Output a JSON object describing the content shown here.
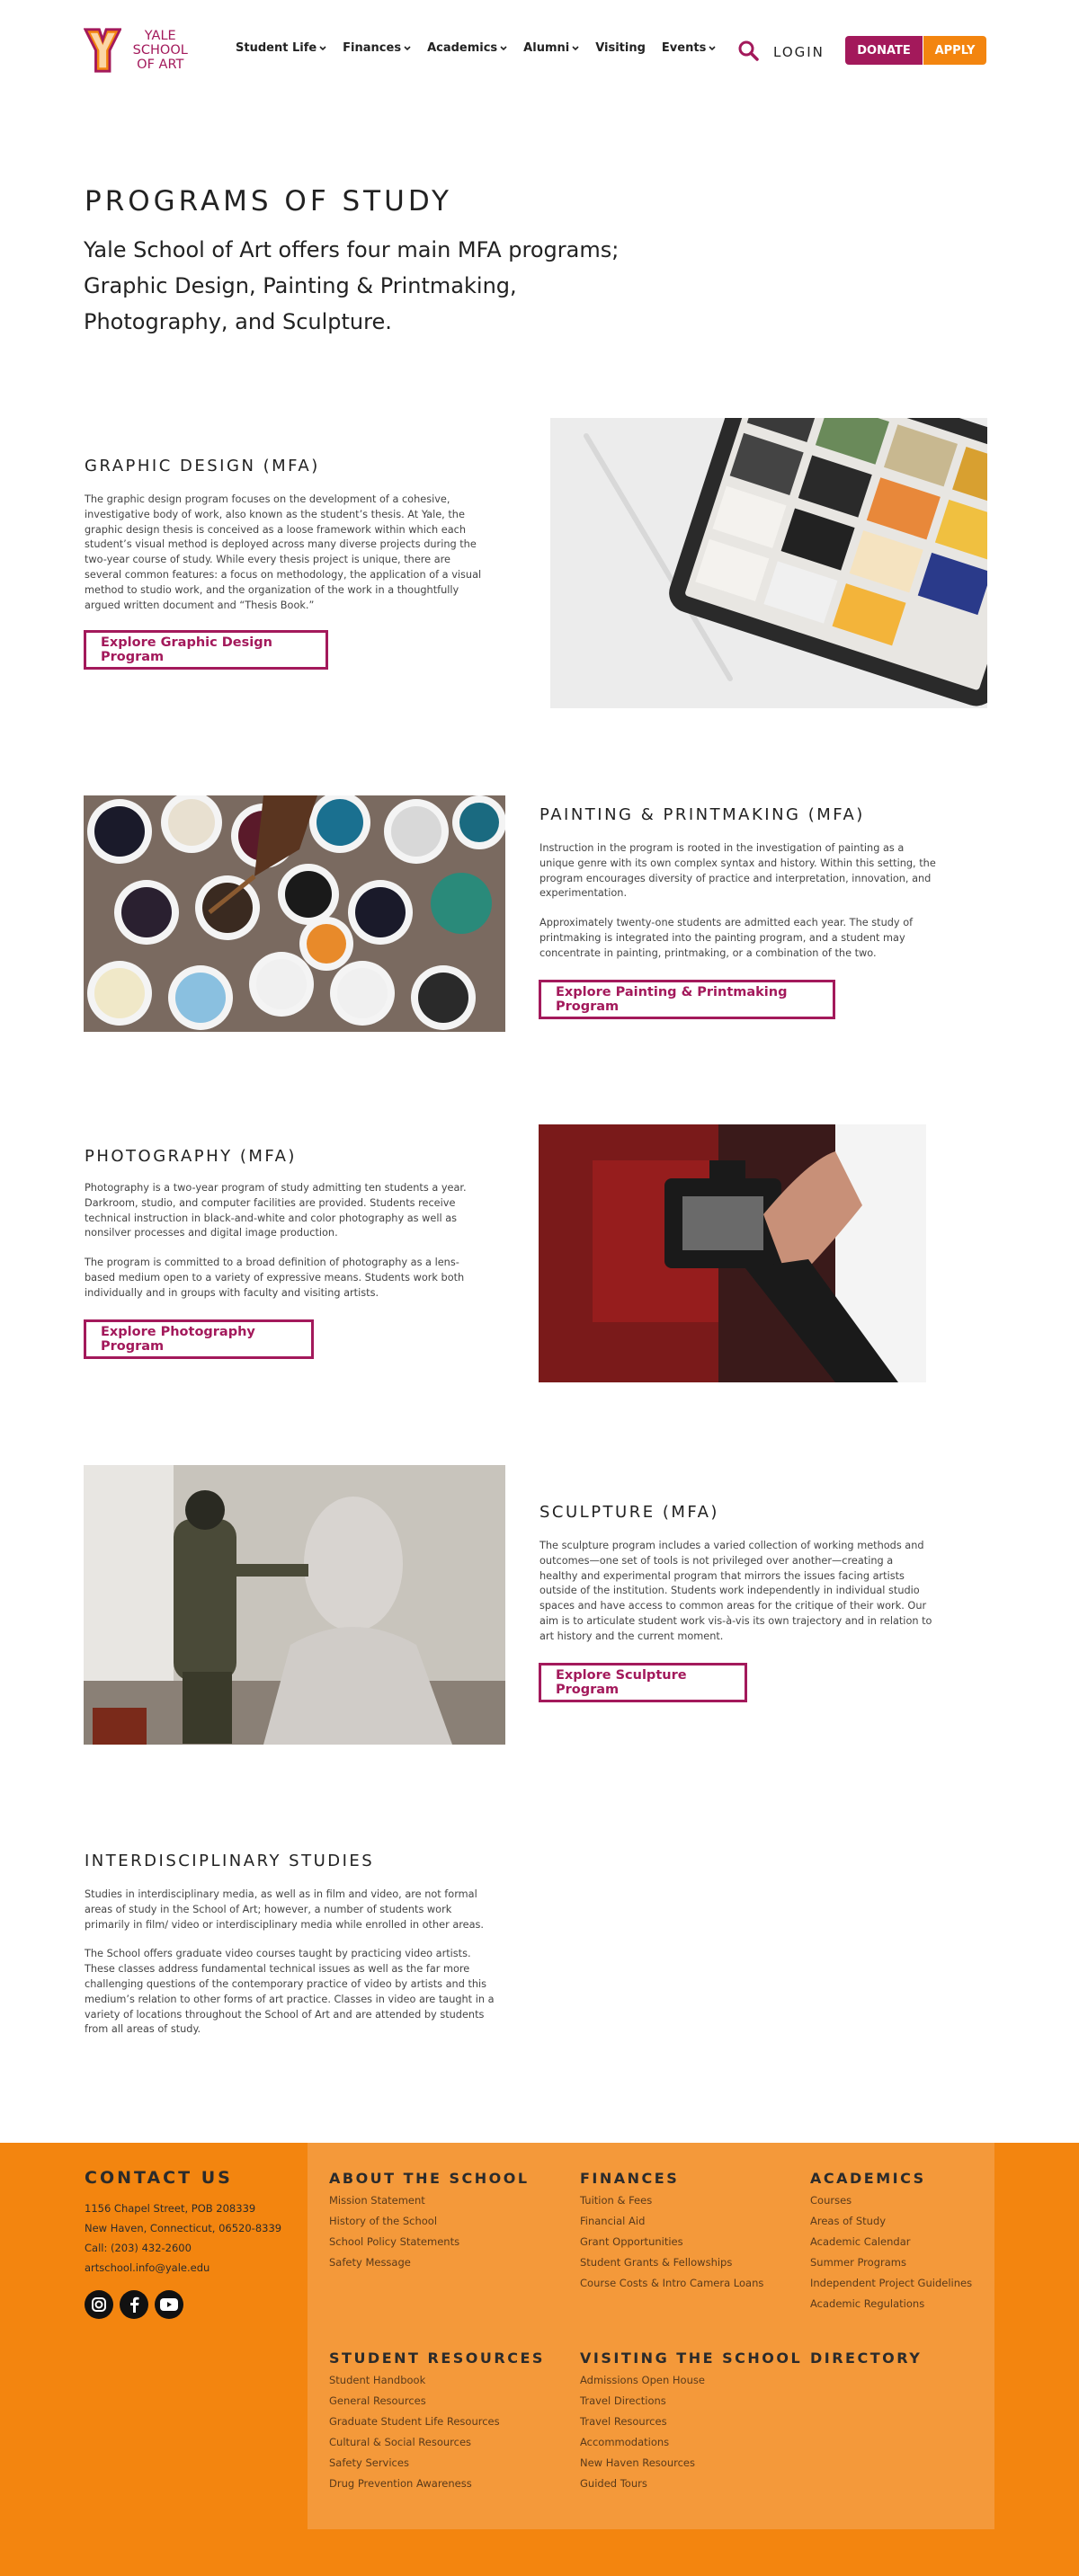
{
  "header": {
    "logo_text": [
      "YALE",
      "SCHOOL",
      "OF ART"
    ],
    "nav": [
      {
        "label": "Student Life",
        "has_dropdown": true
      },
      {
        "label": "Finances",
        "has_dropdown": true
      },
      {
        "label": "Academics",
        "has_dropdown": true
      },
      {
        "label": "Alumni",
        "has_dropdown": true
      },
      {
        "label": "Visiting",
        "has_dropdown": false
      },
      {
        "label": "Events",
        "has_dropdown": true
      }
    ],
    "search_icon": "search-icon",
    "login": "LOGIN",
    "donate": "DONATE",
    "apply": "APPLY",
    "brand_color": "#a3195b",
    "accent_color": "#f3850f"
  },
  "intro": {
    "title": "PROGRAMS OF STUDY",
    "text": "Yale School of Art offers four main MFA programs; Graphic Design, Painting & Printmaking, Photography, and Sculpture."
  },
  "programs": [
    {
      "title": "GRAPHIC DESIGN (MFA)",
      "paragraphs": [
        "The graphic design program focuses on the development of a cohesive, investigative body of work, also known as the student’s thesis. At Yale, the graphic design thesis is conceived as a loose framework within which each student’s visual method is deployed across many diverse projects during the two-year course of study. While every thesis project is unique, there are several common features: a focus on methodology, the application of a visual method to studio work, and the organization of the work in a thoughtfully argued written document and “Thesis Book.”"
      ],
      "button": "Explore Graphic Design Program"
    },
    {
      "title": "PAINTING & PRINTMAKING (MFA)",
      "paragraphs": [
        "Instruction in the program is rooted in the investigation of painting as a unique genre with its own complex syntax and history. Within this setting, the program encourages diversity of practice and interpretation, innovation, and experimentation.",
        "Approximately twenty-one students are admitted each year. The study of printmaking is integrated into the painting program, and a student may concentrate in painting, printmaking, or a combination of the two."
      ],
      "button": "Explore Painting & Printmaking Program"
    },
    {
      "title": "PHOTOGRAPHY (MFA)",
      "paragraphs": [
        "Photography is a two-year program of study admitting ten students a year. Darkroom, studio, and computer facilities are provided. Students receive technical instruction in black-and-white and color photography as well as nonsilver processes and digital image production.",
        "The program is committed to a broad definition of photography as a lens-based medium open to a variety of expressive means. Students work both individually and in groups with faculty and visiting artists."
      ],
      "button": "Explore Photography Program"
    },
    {
      "title": "SCULPTURE (MFA)",
      "paragraphs": [
        "The sculpture program includes a varied collection of working methods and outcomes—one set of tools is not privileged over another—creating a healthy and experimental program that mirrors the issues facing artists outside of the institution. Students work independently in individual studio spaces and have access to common areas for the critique of their work. Our aim is to articulate student work vis-à-vis its own trajectory and in relation to art history and the current moment."
      ],
      "button": "Explore Sculpture Program"
    }
  ],
  "interdisciplinary": {
    "title": "INTERDISCIPLINARY STUDIES",
    "paragraphs": [
      "Studies in interdisciplinary media, as well as in film and video, are not formal areas of study in the School of Art; however, a number of students work primarily in film/ video or interdisciplinary media while enrolled in other areas.",
      "The School offers graduate video courses taught by practicing video artists. These classes address fundamental technical issues as well as the far more challenging questions of the contemporary practice of video by artists and this medium’s relation to other forms of art practice. Classes in video are taught in a variety of locations throughout the School of Art and are attended by students from all areas of study."
    ]
  },
  "footer": {
    "contact": {
      "title": "CONTACT US",
      "lines": [
        "1156 Chapel Street, POB 208339",
        "New Haven, Connecticut, 06520-8339",
        "Call: (203) 432-2600",
        "artschool.info@yale.edu"
      ],
      "social": [
        "instagram-icon",
        "facebook-icon",
        "youtube-icon"
      ]
    },
    "columns": [
      {
        "title": "ABOUT THE SCHOOL",
        "links": [
          "Mission Statement",
          "History of the School",
          "School Policy Statements",
          "Safety Message"
        ]
      },
      {
        "title": "FINANCES",
        "links": [
          "Tuition & Fees",
          "Financial Aid",
          "Grant Opportunities",
          "Student Grants & Fellowships",
          "Course Costs & Intro Camera Loans"
        ]
      },
      {
        "title": "ACADEMICS",
        "links": [
          "Courses",
          "Areas of Study",
          "Academic Calendar",
          "Summer Programs",
          "Independent Project Guidelines",
          "Academic Regulations"
        ]
      },
      {
        "title": "STUDENT RESOURCES",
        "links": [
          "Student Handbook",
          "General Resources",
          "Graduate Student Life Resources",
          "Cultural & Social Resources",
          "Safety Services",
          "Drug Prevention Awareness"
        ]
      },
      {
        "title": "VISITING THE SCHOOL",
        "links": [
          "Admissions Open House",
          "Travel Directions",
          "Travel Resources",
          "Accommodations",
          "New Haven Resources",
          "Guided Tours"
        ]
      },
      {
        "title": "DIRECTORY",
        "links": []
      }
    ]
  }
}
